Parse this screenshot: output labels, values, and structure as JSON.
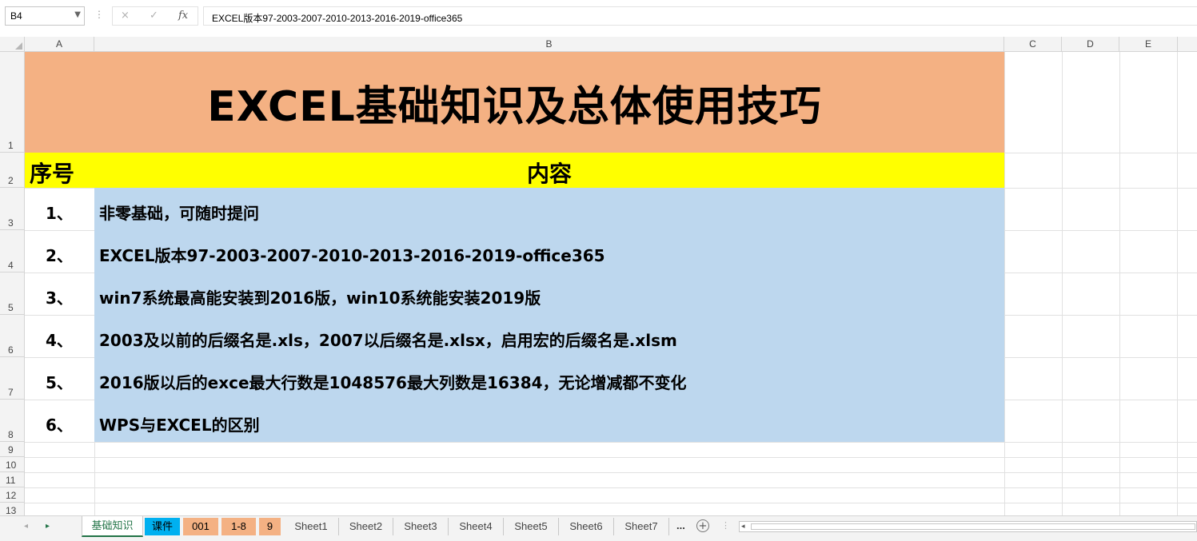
{
  "formula_bar": {
    "name_box": "B4",
    "cancel_icon": "×",
    "confirm_icon": "✓",
    "fx_label": "fx",
    "formula": "EXCEL版本97-2003-2007-2010-2013-2016-2019-office365"
  },
  "columns": [
    "A",
    "B",
    "C",
    "D",
    "E"
  ],
  "rows": [
    "1",
    "2",
    "3",
    "4",
    "5",
    "6",
    "7",
    "8",
    "9",
    "10",
    "11",
    "12",
    "13"
  ],
  "sheet": {
    "title": "EXCEL基础知识及总体使用技巧",
    "header_seq": "序号",
    "header_content": "内容",
    "items": [
      {
        "num": "1、",
        "text": "非零基础，可随时提问"
      },
      {
        "num": "2、",
        "text": "EXCEL版本97-2003-2007-2010-2013-2016-2019-office365"
      },
      {
        "num": "3、",
        "text": "win7系统最高能安装到2016版，win10系统能安装2019版"
      },
      {
        "num": "4、",
        "text": "2003及以前的后缀名是.xls，2007以后缀名是.xlsx，启用宏的后缀名是.xlsm"
      },
      {
        "num": "5、",
        "text": "2016版以后的exce最大行数是1048576最大列数是16384，无论增减都不变化"
      },
      {
        "num": "6、",
        "text": "WPS与EXCEL的区别"
      }
    ]
  },
  "colors": {
    "title_fill": "#f4b183",
    "header_fill": "#ffff00",
    "content_fill": "#bdd7ee",
    "tab_orange": "#f4b183",
    "tab_blue": "#00b0f0",
    "active_tab_text": "#217346"
  },
  "tabs": {
    "prev_icon": "◂",
    "next_icon": "▸",
    "items": [
      {
        "label": "基础知识",
        "style": "active"
      },
      {
        "label": "课件",
        "style": "blue"
      },
      {
        "label": "001",
        "style": "orange"
      },
      {
        "label": "1-8",
        "style": "orange"
      },
      {
        "label": "9",
        "style": "orange"
      },
      {
        "label": "Sheet1",
        "style": "plain"
      },
      {
        "label": "Sheet2",
        "style": "plain"
      },
      {
        "label": "Sheet3",
        "style": "plain"
      },
      {
        "label": "Sheet4",
        "style": "plain"
      },
      {
        "label": "Sheet5",
        "style": "plain"
      },
      {
        "label": "Sheet6",
        "style": "plain"
      },
      {
        "label": "Sheet7",
        "style": "plain"
      }
    ],
    "more_label": "...",
    "add_icon": "+"
  }
}
